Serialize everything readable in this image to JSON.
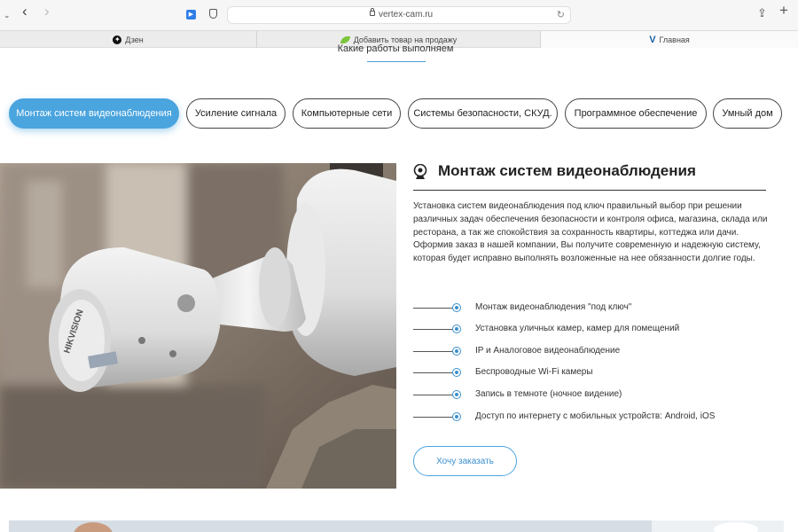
{
  "browser": {
    "url": "vertex-cam.ru",
    "tabs": [
      {
        "label": "Дзен",
        "icon": "dzen-icon"
      },
      {
        "label": "Добавить товар на продажу",
        "icon": "leaf-icon"
      },
      {
        "label": "Главная",
        "icon": "vertex-icon"
      }
    ]
  },
  "section": {
    "heading": "Какие работы выполняем"
  },
  "categories": [
    {
      "label": "Монтаж систем видеонаблюдения",
      "active": true
    },
    {
      "label": "Усиление сигнала",
      "active": false
    },
    {
      "label": "Компьютерные сети",
      "active": false
    },
    {
      "label": "Системы безопасности, СКУД.",
      "active": false
    },
    {
      "label": "Программное обеспечение",
      "active": false
    },
    {
      "label": "Умный дом",
      "active": false
    }
  ],
  "content": {
    "title": "Монтаж систем видеонаблюдения",
    "description": "Установка систем видеонаблюдения под ключ правильный выбор при решении различных задач обеспечения безопасности и контроля офиса, магазина, склада или ресторана, а так же спокойствия за сохранность квартиры, коттеджа или дачи. Оформив заказ в нашей компании, Вы получите современную и надежную систему, которая будет исправно выполнять возложенные на нее обязанности долгие годы.",
    "features": [
      "Монтаж видеонаблюдения \"под ключ\"",
      "Установка уличных камер, камер для помещений",
      "IP и Аналоговое видеонаблюдение",
      "Беспроводные Wi-Fi камеры",
      "Запись в темноте (ночное видение)",
      "Доступ по интернету с мобильных устройств: Android, iOS"
    ],
    "order_button": "Хочу заказать"
  },
  "photo": {
    "camera_brand": "HIKVISION"
  },
  "colors": {
    "accent": "#4aa4de",
    "text": "#222222"
  }
}
